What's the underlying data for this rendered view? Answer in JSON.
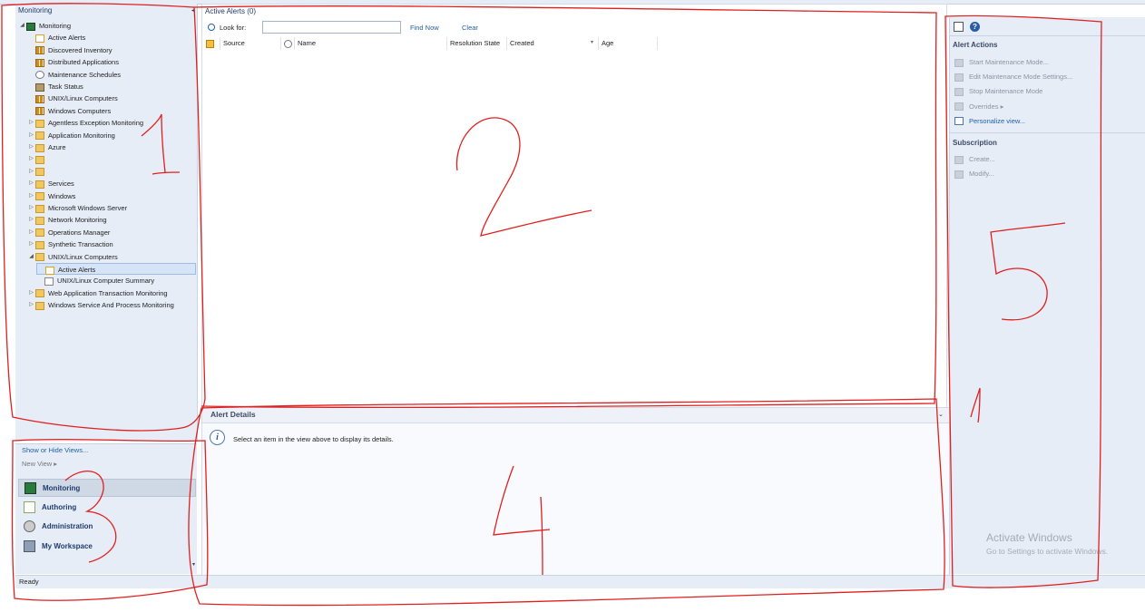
{
  "left_pane": {
    "title": "Monitoring",
    "tree": [
      {
        "label": "Monitoring",
        "icon": "monitoring-icon",
        "level": 0,
        "expander": "◢"
      },
      {
        "label": "Active Alerts",
        "icon": "alert-view-icon",
        "level": 1
      },
      {
        "label": "Discovered Inventory",
        "icon": "state-view-icon",
        "level": 1
      },
      {
        "label": "Distributed Applications",
        "icon": "state-view-icon",
        "level": 1
      },
      {
        "label": "Maintenance Schedules",
        "icon": "schedule-icon",
        "level": 1
      },
      {
        "label": "Task Status",
        "icon": "task-icon",
        "level": 1
      },
      {
        "label": "UNIX/Linux Computers",
        "icon": "state-view-icon",
        "level": 1
      },
      {
        "label": "Windows Computers",
        "icon": "state-view-icon",
        "level": 1
      },
      {
        "label": "Agentless Exception Monitoring",
        "icon": "folder-icon",
        "level": 1,
        "expander": "▷"
      },
      {
        "label": "Application Monitoring",
        "icon": "folder-icon",
        "level": 1,
        "expander": "▷"
      },
      {
        "label": "Azure",
        "icon": "folder-icon",
        "level": 1,
        "expander": "▷"
      },
      {
        "label": "",
        "icon": "folder-icon",
        "level": 1,
        "expander": "▷"
      },
      {
        "label": "",
        "icon": "folder-icon",
        "level": 1,
        "expander": "▷"
      },
      {
        "label": "Services",
        "icon": "folder-icon",
        "level": 1,
        "expander": "▷"
      },
      {
        "label": "Windows",
        "icon": "folder-icon",
        "level": 1,
        "expander": "▷"
      },
      {
        "label": "Microsoft Windows Server",
        "icon": "folder-icon",
        "level": 1,
        "expander": "▷"
      },
      {
        "label": "Network Monitoring",
        "icon": "folder-icon",
        "level": 1,
        "expander": "▷"
      },
      {
        "label": "Operations Manager",
        "icon": "folder-icon",
        "level": 1,
        "expander": "▷"
      },
      {
        "label": "Synthetic Transaction",
        "icon": "folder-icon",
        "level": 1,
        "expander": "▷"
      },
      {
        "label": "UNIX/Linux Computers",
        "icon": "folder-open-icon",
        "level": 1,
        "expander": "◢"
      },
      {
        "label": "Active Alerts",
        "icon": "alert-view-icon",
        "level": 2,
        "selected": true
      },
      {
        "label": "UNIX/Linux Computer Summary",
        "icon": "summary-icon",
        "level": 2
      },
      {
        "label": "Web Application Transaction Monitoring",
        "icon": "folder-icon",
        "level": 1,
        "expander": "▷"
      },
      {
        "label": "Windows Service And Process Monitoring",
        "icon": "folder-icon",
        "level": 1,
        "expander": "▷"
      }
    ]
  },
  "wunderbar": {
    "show_hide_views": "Show or Hide Views...",
    "new_view": "New View ▸",
    "items": [
      {
        "label": "Monitoring",
        "icon": "monitoring-icon",
        "active": true
      },
      {
        "label": "Authoring",
        "icon": "authoring-icon"
      },
      {
        "label": "Administration",
        "icon": "administration-icon"
      },
      {
        "label": "My Workspace",
        "icon": "workspace-icon"
      }
    ],
    "scroll_glyph": "▾"
  },
  "results": {
    "title": "Active Alerts (0)",
    "search": {
      "label": "Look for:",
      "value": "",
      "placeholder": ""
    },
    "find_now": "Find Now",
    "clear": "Clear",
    "columns": [
      "Source",
      "Name",
      "Resolution State",
      "Created",
      "Age"
    ],
    "sort_glyph": "▾",
    "rows": []
  },
  "details": {
    "title": "Alert Details",
    "message": "Select an item in the view above to display its details.",
    "chevron": "⌄",
    "info_glyph": "i"
  },
  "tasks": {
    "help_glyph": "?",
    "alert_actions_title": "Alert Actions",
    "alert_actions": [
      {
        "label": "Start Maintenance Mode...",
        "enabled": false
      },
      {
        "label": "Edit Maintenance Mode Settings...",
        "enabled": false
      },
      {
        "label": "Stop Maintenance Mode",
        "enabled": false
      },
      {
        "label": "Overrides ▸",
        "enabled": false
      },
      {
        "label": "Personalize view...",
        "enabled": true
      }
    ],
    "subscription_title": "Subscription",
    "subscription": [
      {
        "label": "Create...",
        "enabled": false
      },
      {
        "label": "Modify...",
        "enabled": false
      }
    ]
  },
  "watermark": {
    "line1": "Activate Windows",
    "line2": "Go to Settings to activate Windows."
  },
  "statusbar": {
    "text": "Ready"
  },
  "splitter": {
    "collapse_glyph": "◂"
  },
  "annotation_numbers": [
    "1",
    "2",
    "3",
    "4",
    "5"
  ]
}
